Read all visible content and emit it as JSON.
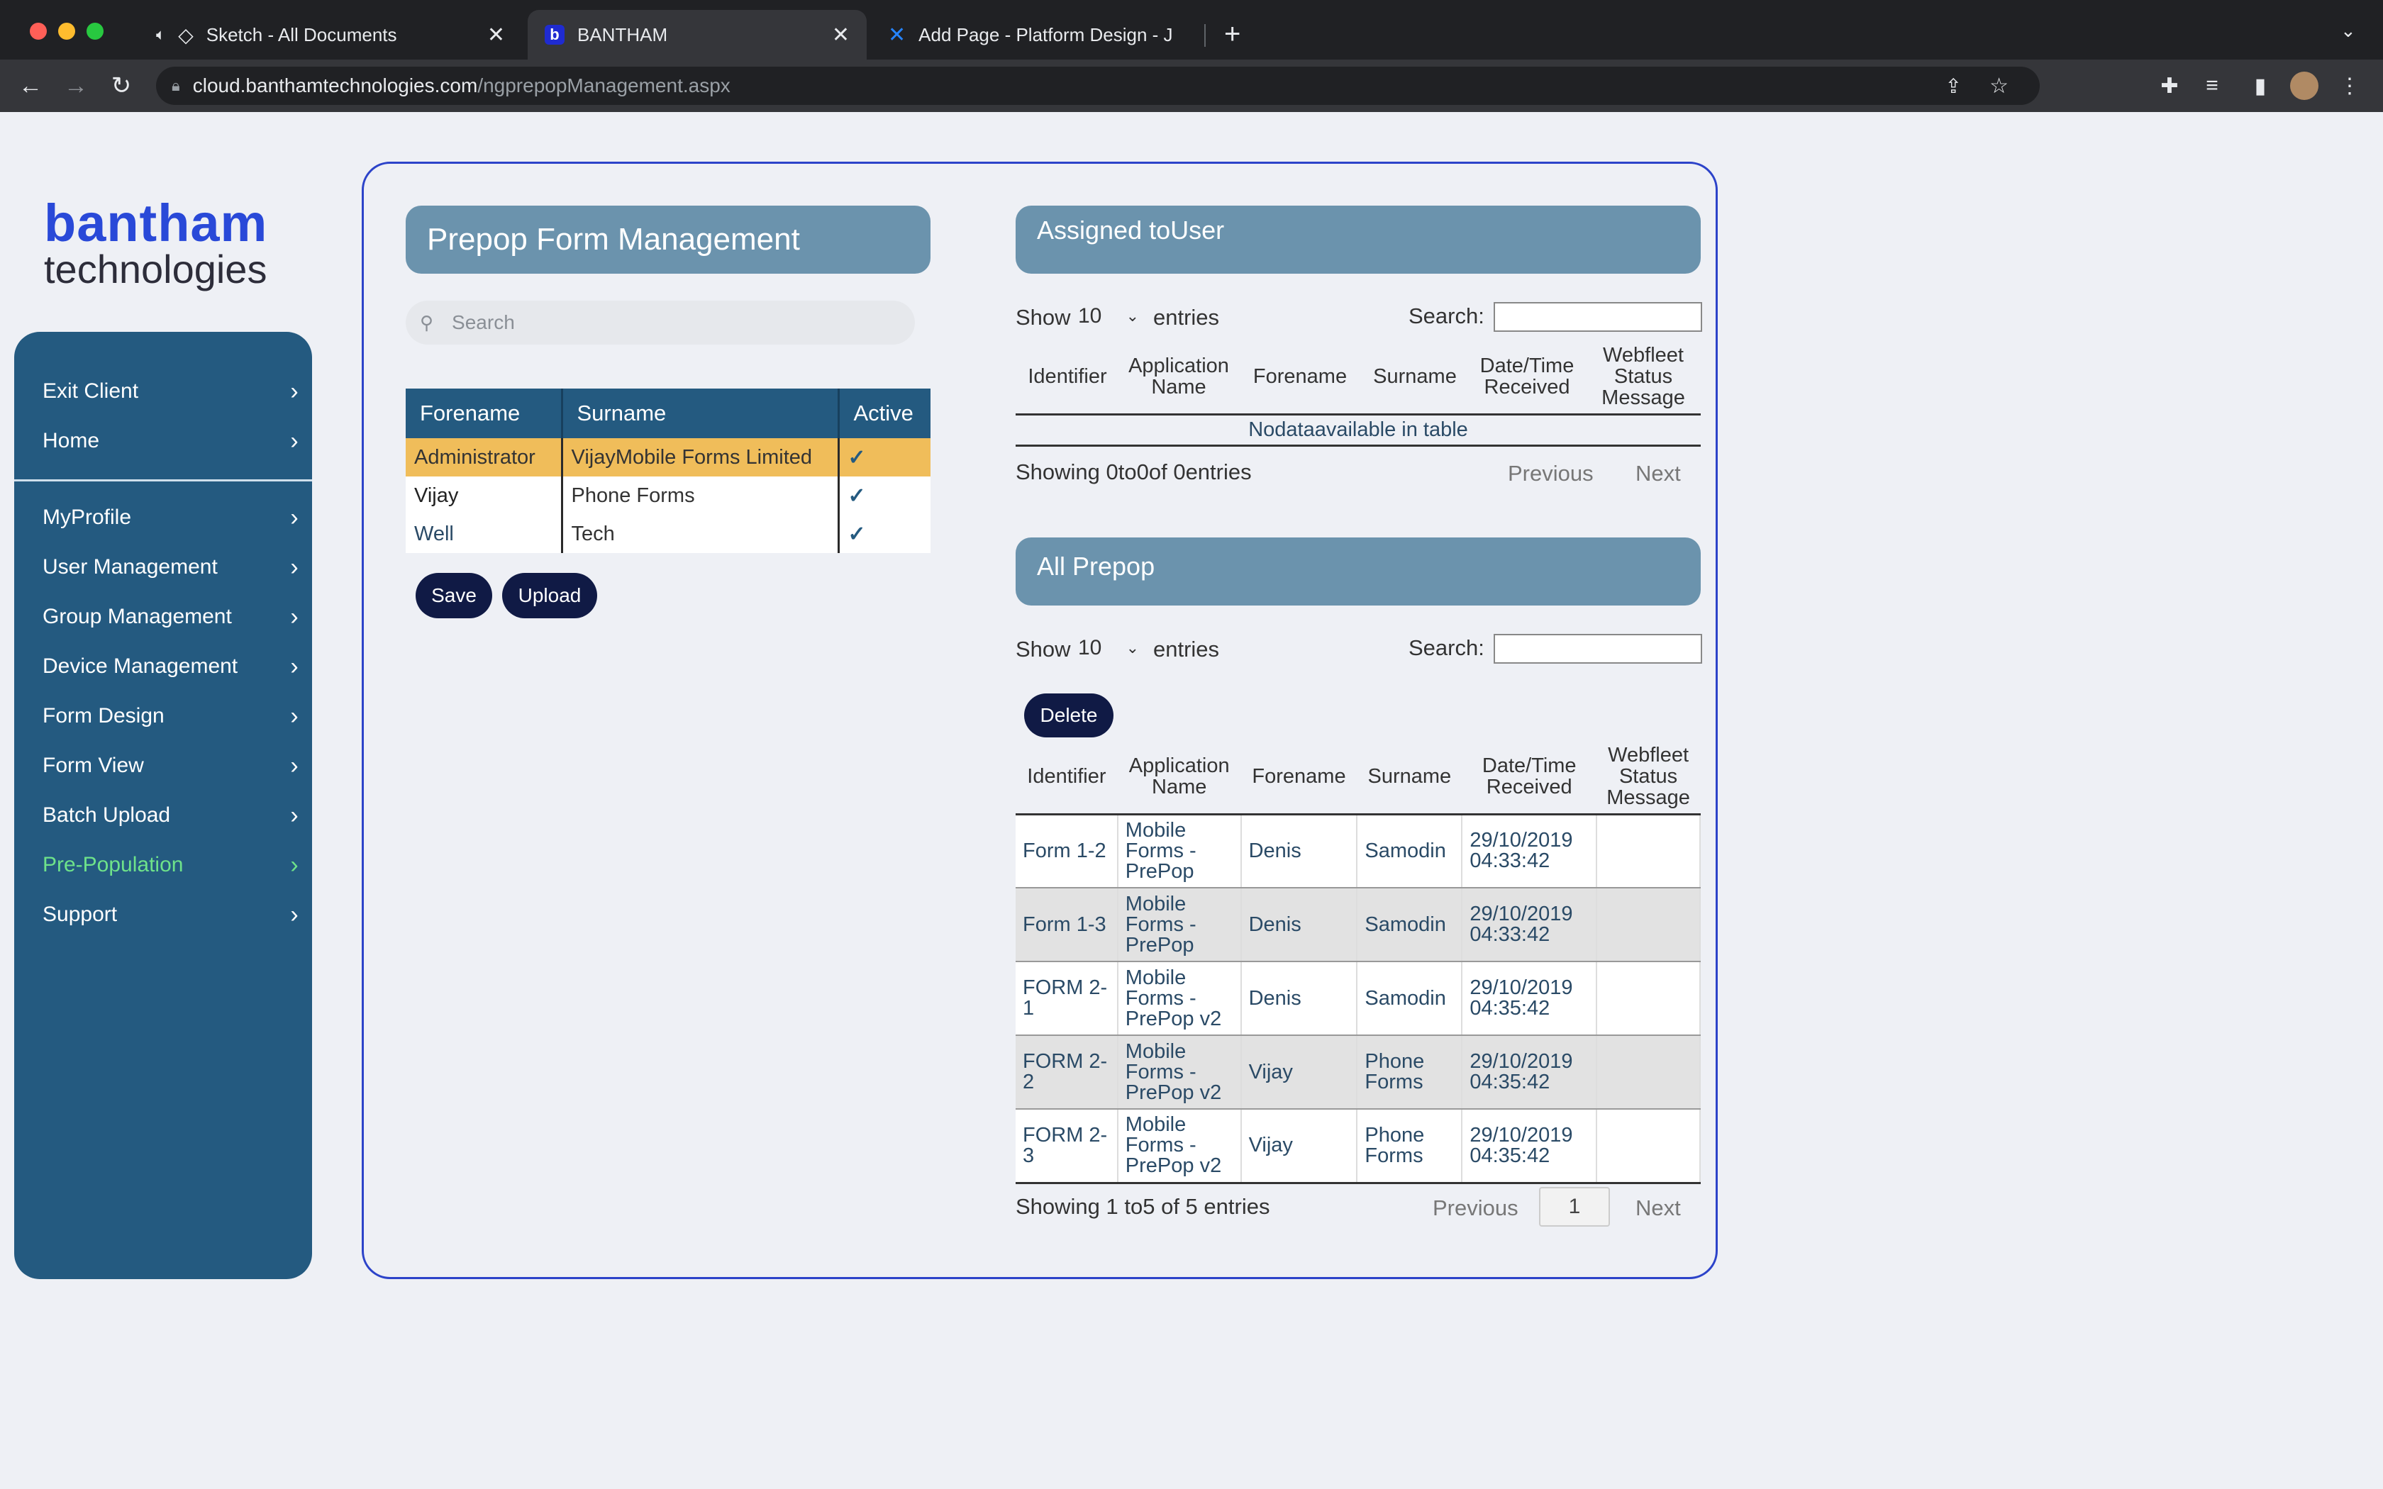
{
  "browser": {
    "tabs": [
      {
        "title": "Sketch - All Documents",
        "active": false
      },
      {
        "title": "BANTHAM",
        "active": true
      },
      {
        "title": "Add Page - Platform Design - J",
        "active": false
      }
    ],
    "url_host": "cloud.banthamtechnologies.com",
    "url_path": "/ngprepopManagement.aspx",
    "icons": [
      "back-icon",
      "forward-icon",
      "reload-icon",
      "lock-icon",
      "share-icon",
      "star-icon",
      "extensions-icon",
      "media-icon",
      "sidepanel-icon",
      "profile-avatar",
      "menu-icon"
    ]
  },
  "brand": {
    "line1": "bantham",
    "line2": "technologies"
  },
  "sidebar": {
    "items": [
      {
        "label": "Exit Client"
      },
      {
        "label": "Home"
      },
      {
        "label": "MyProfile"
      },
      {
        "label": "User Management"
      },
      {
        "label": "Group Management"
      },
      {
        "label": "Device Management"
      },
      {
        "label": "Form Design"
      },
      {
        "label": "Form View"
      },
      {
        "label": "Batch Upload"
      },
      {
        "label": "Pre-Population",
        "active": true
      },
      {
        "label": "Support"
      }
    ]
  },
  "prepop": {
    "title": "Prepop Form Management",
    "search_placeholder": "Search",
    "columns": [
      "Forename",
      "Surname",
      "Active"
    ],
    "rows": [
      {
        "forename": "Administrator",
        "surname": "VijayMobile Forms Limited",
        "active": "✓"
      },
      {
        "forename": "Vijay",
        "surname": "Phone Forms",
        "active": "✓"
      },
      {
        "forename": "Well",
        "surname": "Tech",
        "active": "✓"
      }
    ],
    "save_label": "Save",
    "upload_label": "Upload"
  },
  "assigned": {
    "title": "Assigned toUser",
    "show_label": "Show",
    "page_size": "10",
    "entries_label": "entries",
    "search_label": "Search:",
    "columns": [
      "Identifier",
      "Application Name",
      "Forename",
      "Surname",
      "Date/Time Received",
      "Webfleet Status Message"
    ],
    "empty_message": "Nodataavailable in table",
    "info": "Showing 0to0of 0entries",
    "prev_label": "Previous",
    "next_label": "Next"
  },
  "all_prepop": {
    "title": "All Prepop",
    "show_label": "Show",
    "page_size": "10",
    "entries_label": "entries",
    "search_label": "Search:",
    "delete_label": "Delete",
    "columns": [
      "Identifier",
      "Application Name",
      "Forename",
      "Surname",
      "Date/Time Received",
      "Webfleet Status Message"
    ],
    "rows": [
      {
        "identifier": "Form 1-2",
        "app": "Mobile Forms - PrePop",
        "forename": "Denis",
        "surname": "Samodin",
        "received": "29/10/2019 04:33:42",
        "status": ""
      },
      {
        "identifier": "Form 1-3",
        "app": "Mobile Forms - PrePop",
        "forename": "Denis",
        "surname": "Samodin",
        "received": "29/10/2019 04:33:42",
        "status": ""
      },
      {
        "identifier": "FORM 2-1",
        "app": "Mobile Forms - PrePop v2",
        "forename": "Denis",
        "surname": "Samodin",
        "received": "29/10/2019 04:35:42",
        "status": ""
      },
      {
        "identifier": "FORM 2-2",
        "app": "Mobile Forms - PrePop v2",
        "forename": "Vijay",
        "surname": "Phone Forms",
        "received": "29/10/2019 04:35:42",
        "status": ""
      },
      {
        "identifier": "FORM 2-3",
        "app": "Mobile Forms - PrePop v2",
        "forename": "Vijay",
        "surname": "Phone Forms",
        "received": "29/10/2019 04:35:42",
        "status": ""
      }
    ],
    "info": "Showing 1 to5 of 5 entries",
    "prev_label": "Previous",
    "current_page": "1",
    "next_label": "Next"
  },
  "colors": {
    "sidebar": "#245a80",
    "header": "#6b93ad",
    "selected_row": "#f0bd5a",
    "button": "#101a45",
    "frame_border": "#2c43c9",
    "active_nav": "#6ee28a"
  }
}
